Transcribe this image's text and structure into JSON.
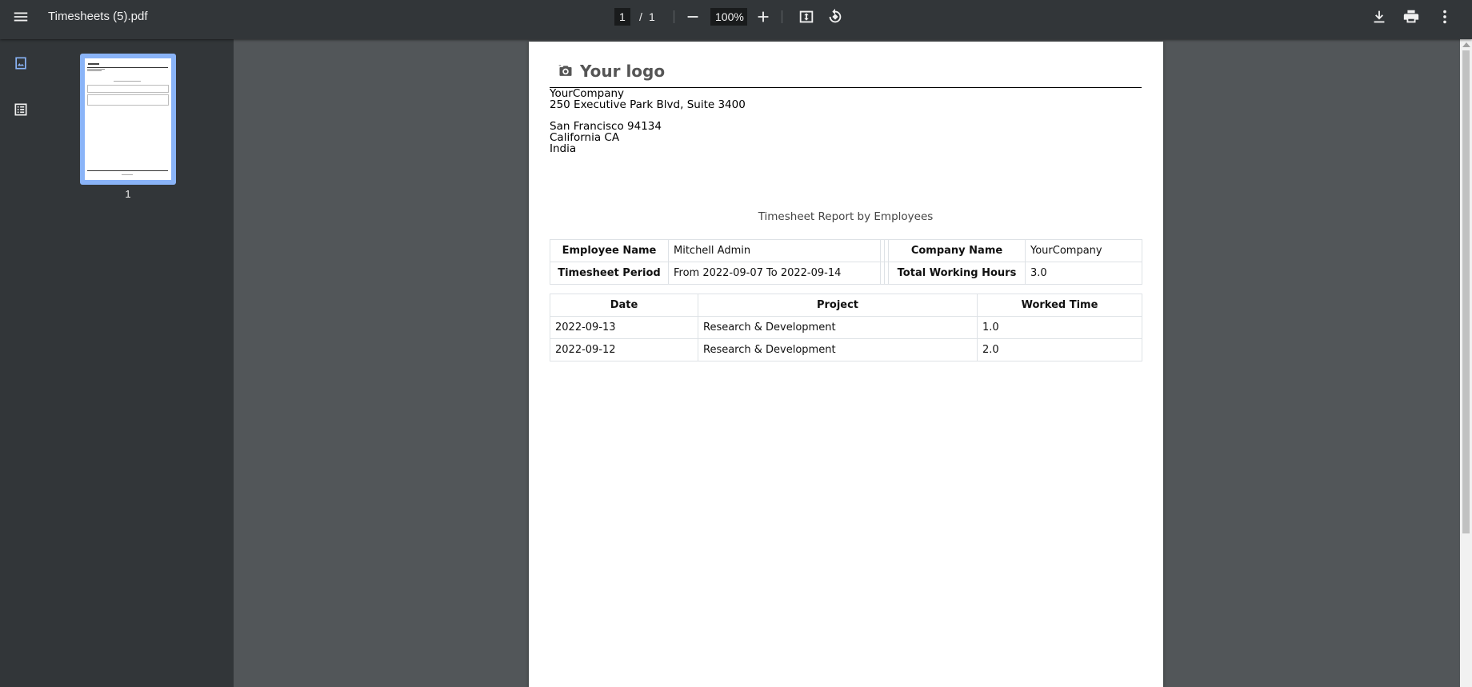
{
  "toolbar": {
    "file_title": "Timesheets (5).pdf",
    "current_page": "1",
    "page_separator": "/",
    "total_pages": "1",
    "zoom": "100%"
  },
  "sidebar": {
    "thumbnail_label": "1"
  },
  "document": {
    "logo_text": "Your logo",
    "company_lines": [
      "YourCompany",
      "250 Executive Park Blvd, Suite 3400",
      "",
      "San Francisco 94134",
      "California CA",
      "India"
    ],
    "report_title": "Timesheet Report by Employees",
    "summary": {
      "employee_name_label": "Employee Name",
      "employee_name": "Mitchell Admin",
      "company_name_label": "Company Name",
      "company_name": "YourCompany",
      "period_label": "Timesheet Period",
      "period": "From 2022-09-07 To 2022-09-14",
      "total_hours_label": "Total Working Hours",
      "total_hours": "3.0"
    },
    "lines_table": {
      "headers": [
        "Date",
        "Project",
        "Worked Time"
      ],
      "rows": [
        [
          "2022-09-13",
          "Research & Development",
          "1.0"
        ],
        [
          "2022-09-12",
          "Research & Development",
          "2.0"
        ]
      ]
    }
  }
}
